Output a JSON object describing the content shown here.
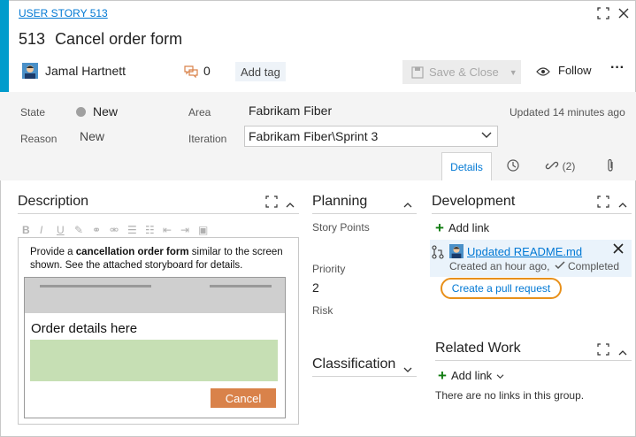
{
  "header": {
    "type_link": "USER STORY 513",
    "id": "513",
    "title": "Cancel order form",
    "assignee": "Jamal Hartnett",
    "comment_count": "0",
    "add_tag": "Add tag",
    "save_close": "Save & Close",
    "follow": "Follow",
    "more": "···"
  },
  "fields": {
    "state_label": "State",
    "state_value": "New",
    "reason_label": "Reason",
    "reason_value": "New",
    "area_label": "Area",
    "area_value": "Fabrikam Fiber",
    "iteration_label": "Iteration",
    "iteration_value": "Fabrikam Fiber\\Sprint 3",
    "updated": "Updated 14 minutes ago"
  },
  "tabs": {
    "details": "Details",
    "links_count": "(2)"
  },
  "description": {
    "title": "Description",
    "text_before": "Provide a ",
    "text_bold": "cancellation order form",
    "text_after": " similar to the screen shown. See the attached storyboard for details.",
    "mock_heading": "Order details here",
    "mock_cancel": "Cancel"
  },
  "planning": {
    "title": "Planning",
    "story_points_label": "Story Points",
    "priority_label": "Priority",
    "priority_value": "2",
    "risk_label": "Risk"
  },
  "classification": {
    "title": "Classification"
  },
  "development": {
    "title": "Development",
    "add_link": "Add link",
    "item_link": "Updated README.md",
    "item_meta": "Created an hour ago,",
    "item_status": "Completed",
    "create_pr": "Create a pull request"
  },
  "related_work": {
    "title": "Related Work",
    "add_link": "Add link",
    "empty": "There are no links in this group."
  },
  "colors": {
    "accent": "#009ccc",
    "link": "#0078d4",
    "highlight_ring": "#e8901a",
    "state_dot": "#a0a0a0",
    "cancel_button": "#d9824a",
    "mock_green": "#c6dfb4"
  }
}
